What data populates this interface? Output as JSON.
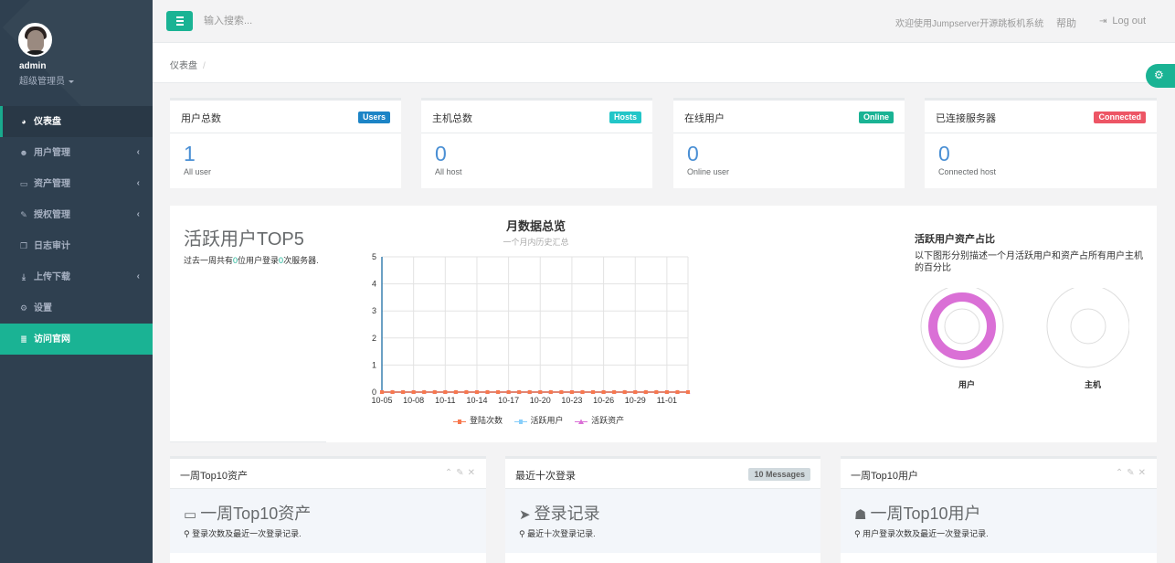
{
  "profile": {
    "name": "admin",
    "role": "超级管理员"
  },
  "sidebar": {
    "items": [
      {
        "label": "仪表盘",
        "icon": "tachometer-icon"
      },
      {
        "label": "用户管理",
        "icon": "users-icon"
      },
      {
        "label": "资产管理",
        "icon": "inbox-icon"
      },
      {
        "label": "授权管理",
        "icon": "edit-icon"
      },
      {
        "label": "日志审计",
        "icon": "copy-icon"
      },
      {
        "label": "上传下载",
        "icon": "download-icon"
      },
      {
        "label": "设置",
        "icon": "gears-icon"
      },
      {
        "label": "访问官网",
        "icon": "database-icon"
      }
    ]
  },
  "topbar": {
    "search_placeholder": "输入搜索...",
    "welcome": "欢迎使用Jumpserver开源跳板机系统",
    "help": "帮助",
    "logout": "Log out"
  },
  "breadcrumb": {
    "current": "仪表盘",
    "separator": "/"
  },
  "stats": [
    {
      "title": "用户总数",
      "badge": "Users",
      "badge_color": "#1c84c6",
      "value": "1",
      "sub": "All user"
    },
    {
      "title": "主机总数",
      "badge": "Hosts",
      "badge_color": "#23c6c8",
      "value": "0",
      "sub": "All host"
    },
    {
      "title": "在线用户",
      "badge": "Online",
      "badge_color": "#1ab394",
      "value": "0",
      "sub": "Online user"
    },
    {
      "title": "已连接服务器",
      "badge": "Connected",
      "badge_color": "#ed5565",
      "value": "0",
      "sub": "Connected host"
    }
  ],
  "top5": {
    "title": "活跃用户TOP5",
    "desc_prefix": "过去一周共有",
    "user_count": "0",
    "desc_mid": "位用户登录",
    "server_count": "0",
    "desc_suffix": "次服务器."
  },
  "chart_data": {
    "type": "line",
    "title": "月数据总览",
    "subtitle": "一个月内历史汇总",
    "x": [
      "10-05",
      "10-06",
      "10-07",
      "10-08",
      "10-09",
      "10-10",
      "10-11",
      "10-12",
      "10-13",
      "10-14",
      "10-15",
      "10-16",
      "10-17",
      "10-18",
      "10-19",
      "10-20",
      "10-21",
      "10-22",
      "10-23",
      "10-24",
      "10-25",
      "10-26",
      "10-27",
      "10-28",
      "10-29",
      "10-30",
      "10-31",
      "11-01",
      "11-02",
      "11-03"
    ],
    "tick_labels": [
      "10-05",
      "10-08",
      "10-11",
      "10-14",
      "10-17",
      "10-20",
      "10-23",
      "10-26",
      "10-29",
      "11-01"
    ],
    "ylim": [
      0,
      5
    ],
    "yticks": [
      "0",
      "1",
      "2",
      "3",
      "4",
      "5"
    ],
    "grid": true,
    "series": [
      {
        "name": "登陆次数",
        "color": "#f7784e",
        "marker": "square",
        "values": [
          0,
          0,
          0,
          0,
          0,
          0,
          0,
          0,
          0,
          0,
          0,
          0,
          0,
          0,
          0,
          0,
          0,
          0,
          0,
          0,
          0,
          0,
          0,
          0,
          0,
          0,
          0,
          0,
          0,
          0
        ]
      },
      {
        "name": "活跃用户",
        "color": "#87cefa",
        "marker": "square",
        "values": [
          0,
          0,
          0,
          0,
          0,
          0,
          0,
          0,
          0,
          0,
          0,
          0,
          0,
          0,
          0,
          0,
          0,
          0,
          0,
          0,
          0,
          0,
          0,
          0,
          0,
          0,
          0,
          0,
          0,
          0
        ]
      },
      {
        "name": "活跃资产",
        "color": "#da70d6",
        "marker": "triangle",
        "values": [
          0,
          0,
          0,
          0,
          0,
          0,
          0,
          0,
          0,
          0,
          0,
          0,
          0,
          0,
          0,
          0,
          0,
          0,
          0,
          0,
          0,
          0,
          0,
          0,
          0,
          0,
          0,
          0,
          0,
          0
        ]
      }
    ],
    "legend_position": "bottom"
  },
  "ratio": {
    "title": "活跃用户资产占比",
    "desc": "以下图形分别描述一个月活跃用户和资产占所有用户主机的百分比",
    "user_label": "用户",
    "user_color": "#da70d6",
    "host_label": "主机"
  },
  "bottom": [
    {
      "title": "一周Top10资产",
      "big": "一周Top10资产",
      "icon": "inbox-icon",
      "small": "登录次数及最近一次登录记录."
    },
    {
      "title": "最近十次登录",
      "badge": "10 Messages",
      "big": "登录记录",
      "icon": "paper-plane-icon",
      "small": "最近十次登录记录."
    },
    {
      "title": "一周Top10用户",
      "big": "一周Top10用户",
      "icon": "user-icon",
      "small": "用户登录次数及最近一次登录记录."
    }
  ]
}
